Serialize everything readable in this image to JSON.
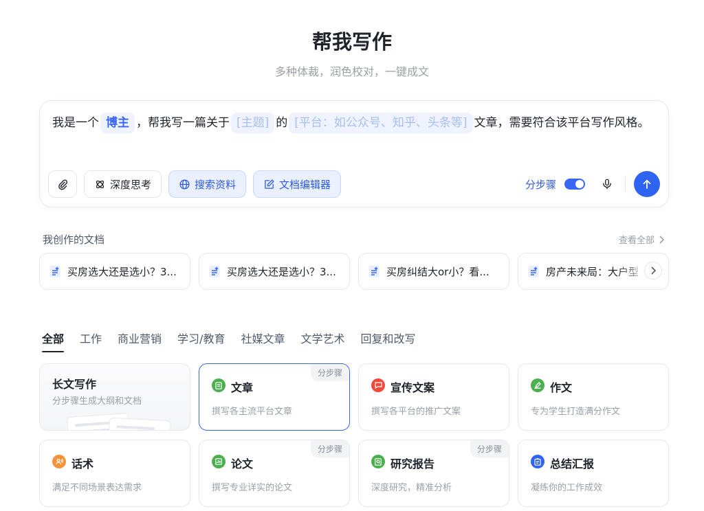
{
  "header": {
    "title": "帮我写作",
    "subtitle": "多种体裁，润色校对，一键成文"
  },
  "composer": {
    "prompt_parts": {
      "p1": "我是一个",
      "chip_role": "博主",
      "p2": "，帮我写一篇关于",
      "chip_topic": "[主题]",
      "p3": "的",
      "chip_platform": "[平台：如公众号、知乎、头条等]",
      "p4": "文章，需要符合该平台写作风格。"
    },
    "tools": {
      "deep_think": "深度思考",
      "search": "搜索资料",
      "doc_editor": "文档编辑器"
    },
    "step_toggle_label": "分步骤",
    "step_toggle_on": true
  },
  "my_docs": {
    "label": "我创作的文档",
    "view_all": "查看全部",
    "items": [
      {
        "title": "买房选大还是选小？3..."
      },
      {
        "title": "买房选大还是选小？3..."
      },
      {
        "title": "买房纠结大or小？看..."
      },
      {
        "title": "房产未来局：大户型"
      }
    ]
  },
  "tabs": [
    "全部",
    "工作",
    "商业营销",
    "学习/教育",
    "社媒文章",
    "文学艺术",
    "回复和改写"
  ],
  "cards": [
    {
      "title": "长文写作",
      "desc": "分步骤生成大纲和文档"
    },
    {
      "title": "文章",
      "desc": "撰写各主流平台文章",
      "badge": "分步骤",
      "icon_color": "#4caf50"
    },
    {
      "title": "宣传文案",
      "desc": "撰写各平台的推广文案",
      "icon_color": "#f04a3e"
    },
    {
      "title": "作文",
      "desc": "专为学生打造满分作文",
      "icon_color": "#4caf50"
    },
    {
      "title": "话术",
      "desc": "满足不同场景表达需求",
      "icon_color": "#f5923a"
    },
    {
      "title": "论文",
      "desc": "撰写专业详实的论文",
      "badge": "分步骤",
      "icon_color": "#4caf50"
    },
    {
      "title": "研究报告",
      "desc": "深度研究，精准分析",
      "badge": "分步骤",
      "icon_color": "#4caf50"
    },
    {
      "title": "总结汇报",
      "desc": "凝练你的工作成效",
      "icon_color": "#2f63f1"
    }
  ]
}
